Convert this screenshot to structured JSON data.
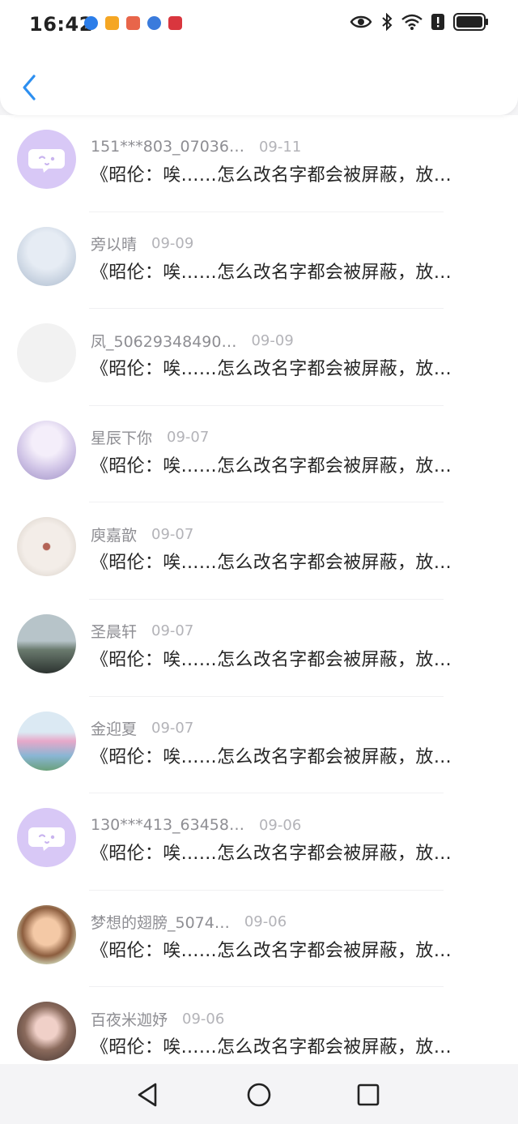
{
  "status_bar": {
    "time": "16:42",
    "notification_icons": [
      "check-badge-icon",
      "video-app-icon",
      "book-app-icon",
      "browser-app-icon",
      "huawei-app-icon"
    ],
    "right_icons": [
      "eye-icon",
      "bluetooth-icon",
      "wifi-icon",
      "alert-icon",
      "battery-icon"
    ]
  },
  "header": {
    "back_icon": "chevron-left-icon"
  },
  "messages": [
    {
      "name": "151***803_07036…",
      "date": "09-11",
      "text": "《昭伦：唉……怎么改名字都会被屏蔽，放…",
      "avatar": "chat-bubble"
    },
    {
      "name": "旁以晴",
      "date": "09-09",
      "text": "《昭伦：唉……怎么改名字都会被屏蔽，放…",
      "avatar": "husky-dog"
    },
    {
      "name": "凤_50629348490…",
      "date": "09-09",
      "text": "《昭伦：唉……怎么改名字都会被屏蔽，放…",
      "avatar": "sketch"
    },
    {
      "name": "星辰下你",
      "date": "09-07",
      "text": "《昭伦：唉……怎么改名字都会被屏蔽，放…",
      "avatar": "anime-girl-white-hair"
    },
    {
      "name": "庾嘉歆",
      "date": "09-07",
      "text": "《昭伦：唉……怎么改名字都会被屏蔽，放…",
      "avatar": "white-flower"
    },
    {
      "name": "圣晨轩",
      "date": "09-07",
      "text": "《昭伦：唉……怎么改名字都会被屏蔽，放…",
      "avatar": "girl-silhouette"
    },
    {
      "name": "金迎夏",
      "date": "09-07",
      "text": "《昭伦：唉……怎么改名字都会被屏蔽，放…",
      "avatar": "blossom-tree"
    },
    {
      "name": "130***413_63458…",
      "date": "09-06",
      "text": "《昭伦：唉……怎么改名字都会被屏蔽，放…",
      "avatar": "chat-bubble"
    },
    {
      "name": "梦想的翅膀_5074…",
      "date": "09-06",
      "text": "《昭伦：唉……怎么改名字都会被屏蔽，放…",
      "avatar": "cartoon-girl"
    },
    {
      "name": "百夜米迦妤",
      "date": "09-06",
      "text": "《昭伦：唉……怎么改名字都会被屏蔽，放…",
      "avatar": "anime-girl-brown-hair"
    }
  ],
  "nav_bar": {
    "icons": [
      "back-triangle-icon",
      "home-circle-icon",
      "recents-square-icon"
    ]
  },
  "colors": {
    "accent": "#2d8ff0",
    "bubble_avatar": "#d8c8f6"
  }
}
